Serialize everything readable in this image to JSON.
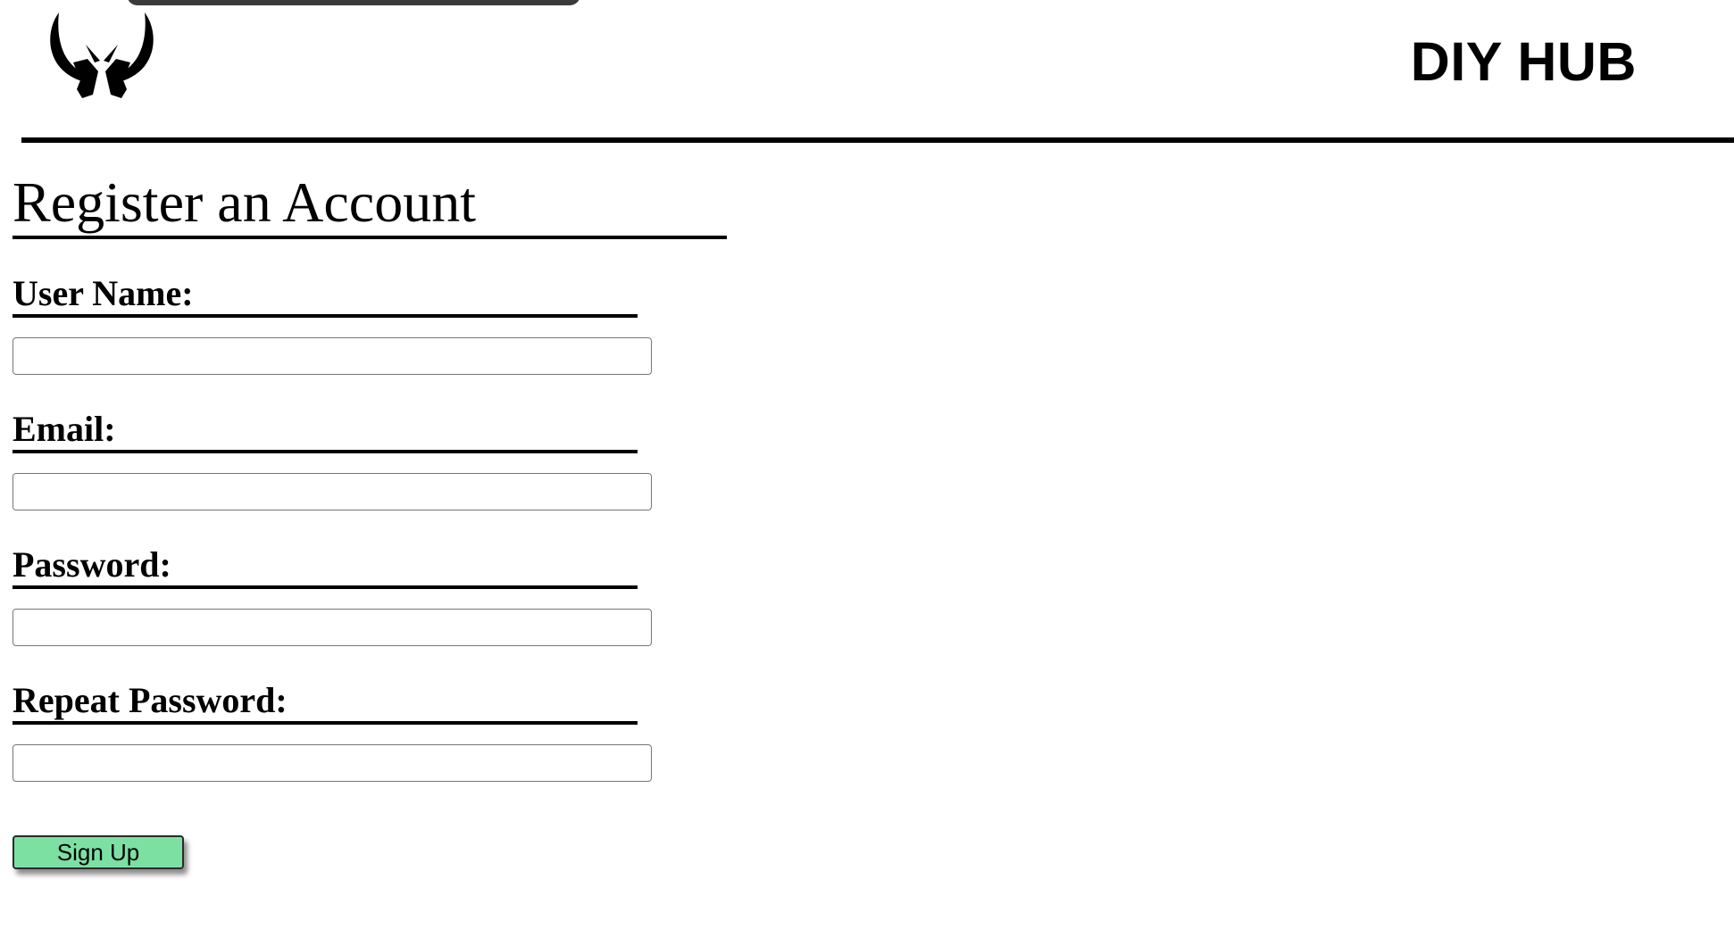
{
  "header": {
    "logo_icon": "horned-helmet-logo-icon",
    "brand": "DIY HUB"
  },
  "form": {
    "title": "Register an Account",
    "fields": [
      {
        "label": "User Name:",
        "value": "",
        "placeholder": ""
      },
      {
        "label": "Email:",
        "value": "",
        "placeholder": ""
      },
      {
        "label": "Password:",
        "value": "",
        "placeholder": ""
      },
      {
        "label": "Repeat Password:",
        "value": "",
        "placeholder": ""
      }
    ],
    "submit_label": "Sign Up"
  },
  "colors": {
    "button_bg": "#7ce0a3",
    "text": "#000000",
    "background": "#ffffff"
  }
}
